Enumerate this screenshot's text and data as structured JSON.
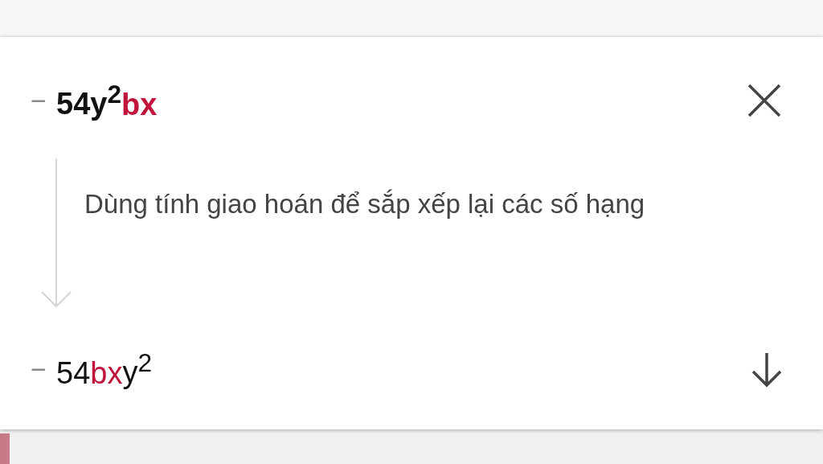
{
  "steps": [
    {
      "kind": "start",
      "sign": "−",
      "bold": true,
      "tokens": [
        {
          "text": "54y$^{2}$",
          "highlighted": false
        },
        {
          "text": "bx",
          "highlighted": true
        }
      ]
    },
    {
      "kind": "explanation",
      "explanation": "Dùng tính giao hoán để sắp xếp lại các số hạng"
    },
    {
      "kind": "result",
      "sign": "−",
      "bold": false,
      "tokens": [
        {
          "text": "54",
          "highlighted": false
        },
        {
          "text": "bx",
          "highlighted": true
        },
        {
          "text": "y$^{2}$",
          "highlighted": false
        }
      ]
    }
  ]
}
